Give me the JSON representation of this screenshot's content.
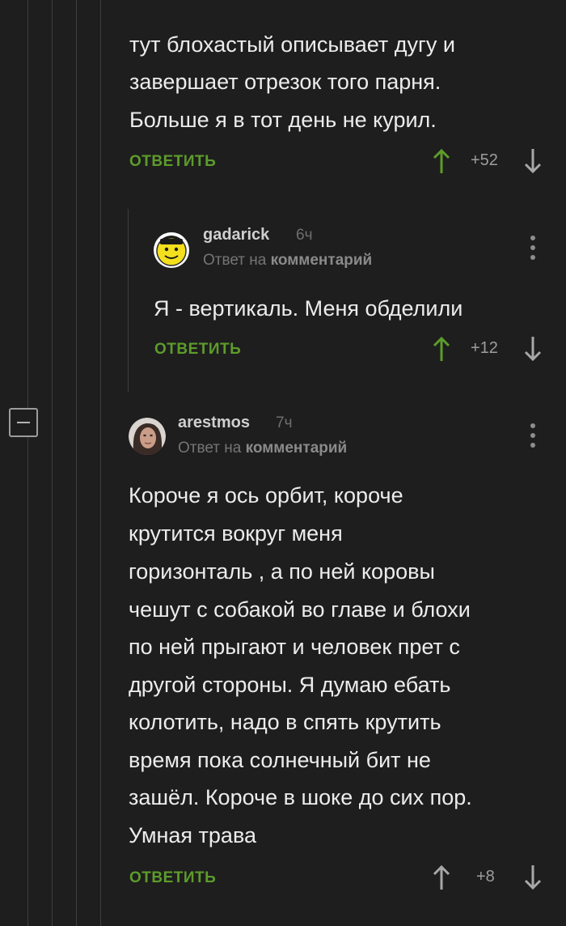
{
  "comments": [
    {
      "lines": [
        "тут блохастый описывает дугу и",
        "завершает отрезок того парня.",
        " Больше я в тот день не курил."
      ],
      "reply_label": "ОТВЕТИТЬ",
      "rating": "+52",
      "upvote_color": "#5d9c2b"
    },
    {
      "username": "gadarick",
      "time": "6ч",
      "reply_to_prefix": "Ответ на",
      "reply_to_target": "комментарий",
      "lines": [
        "Я - вертикаль. Меня обделили"
      ],
      "reply_label": "ОТВЕТИТЬ",
      "rating": "+12",
      "upvote_color": "#5d9c2b",
      "avatar_icon": "yellow-smiley-face"
    },
    {
      "username": "arestmos",
      "time": "7ч",
      "reply_to_prefix": "Ответ на",
      "reply_to_target": "комментарий",
      "lines": [
        "Короче я ось орбит, короче",
        "крутится вокруг меня",
        "горизонталь , а по ней коровы",
        "чешут с собакой во главе и блохи",
        "по ней прыгают и человек прет с",
        "другой стороны. Я думаю ебать",
        "колотить, надо в спять крутить",
        "время пока солнечный бит не",
        "зашёл. Короче в шоке до сих пор.",
        "Умная трава"
      ],
      "reply_label": "ОТВЕТИТЬ",
      "rating": "+8",
      "upvote_color": "#a8a8a8",
      "avatar_icon": "user-photo"
    }
  ],
  "colors": {
    "background": "#1e1e1e",
    "accent_green": "#5d9c2b",
    "text": "#ececec",
    "muted": "#757575"
  }
}
